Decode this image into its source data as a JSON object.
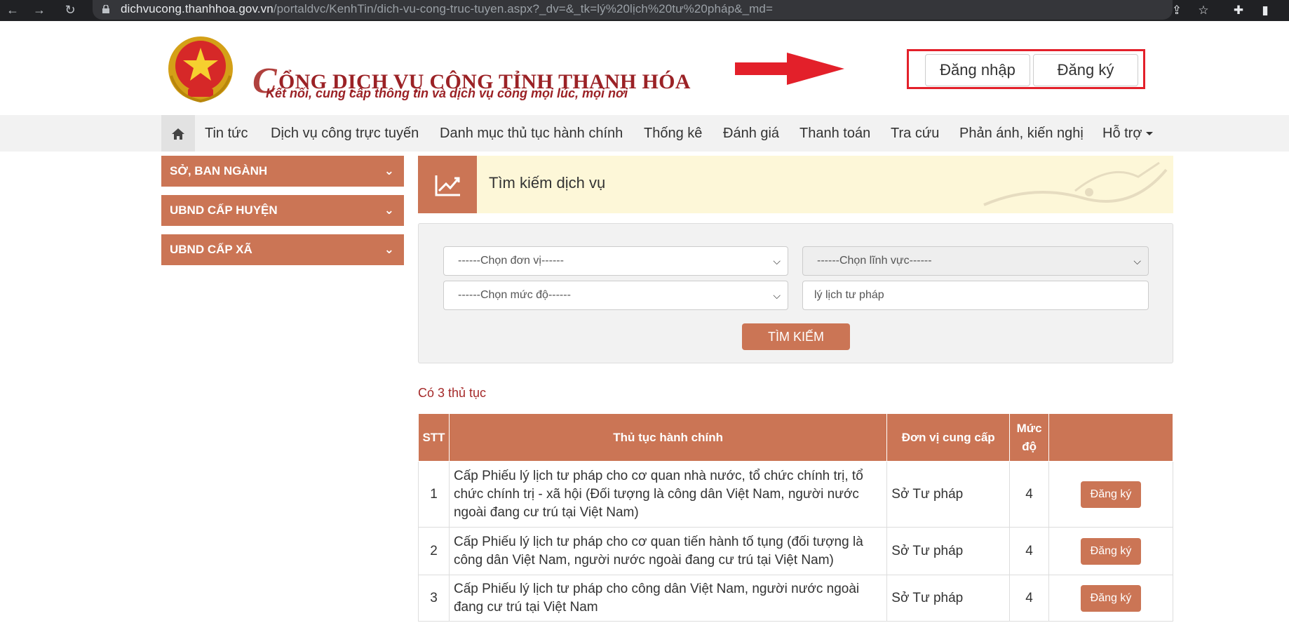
{
  "browser": {
    "url_host": "dichvucong.thanhhoa.gov.vn",
    "url_path": "/portaldvc/KenhTin/dich-vu-cong-truc-tuyen.aspx?_dv=&_tk=lý%20lịch%20tư%20pháp&_md="
  },
  "header": {
    "logo_letter": "C",
    "logo_title_rest": "ỔNG DỊCH VỤ CÔNG TỈNH THANH HÓA",
    "tagline": "Kết nối, cung cấp thông tin và dịch vụ công mọi lúc, mọi nơi",
    "login_label": "Đăng nhập",
    "register_label": "Đăng ký"
  },
  "nav": {
    "items": [
      "Tin tức",
      "Dịch vụ công trực tuyến",
      "Danh mục thủ tục hành chính",
      "Thống kê",
      "Đánh giá",
      "Thanh toán",
      "Tra cứu",
      "Phản ánh, kiến nghị",
      "Hỗ trợ"
    ]
  },
  "sidebar": {
    "items": [
      "SỞ, BAN NGÀNH",
      "UBND CẤP HUYỆN",
      "UBND CẤP XÃ"
    ]
  },
  "search": {
    "title": "Tìm kiếm dịch vụ",
    "unit_select": "------Chọn đơn vị------",
    "field_select": "------Chọn lĩnh vực------",
    "level_select": "------Chọn mức độ------",
    "keyword_value": "lý lịch tư pháp",
    "button_label": "TÌM KIẾM"
  },
  "results": {
    "count_text": "Có 3 thủ tục",
    "headers": {
      "stt": "STT",
      "procedure": "Thủ tục hành chính",
      "provider": "Đơn vị cung cấp",
      "level": "Mức độ"
    },
    "rows": [
      {
        "stt": "1",
        "procedure": "Cấp Phiếu lý lịch tư pháp cho cơ quan nhà nước, tổ chức chính trị, tổ chức chính trị - xã hội (Đối tượng là công dân Việt Nam, người nước ngoài đang cư trú tại Việt Nam)",
        "provider": "Sở Tư pháp",
        "level": "4",
        "action": "Đăng ký"
      },
      {
        "stt": "2",
        "procedure": "Cấp Phiếu lý lịch tư pháp cho cơ quan tiến hành tố tụng (đối tượng là công dân Việt Nam, người nước ngoài đang cư trú tại Việt Nam)",
        "provider": "Sở Tư pháp",
        "level": "4",
        "action": "Đăng ký"
      },
      {
        "stt": "3",
        "procedure": "Cấp Phiếu lý lịch tư pháp cho công dân Việt Nam, người nước ngoài đang cư trú tại Việt Nam",
        "provider": "Sở Tư pháp",
        "level": "4",
        "action": "Đăng ký"
      }
    ]
  },
  "colors": {
    "accent": "#cb7555",
    "brand_red": "#9b2226",
    "highlight_red": "#e3202a"
  }
}
